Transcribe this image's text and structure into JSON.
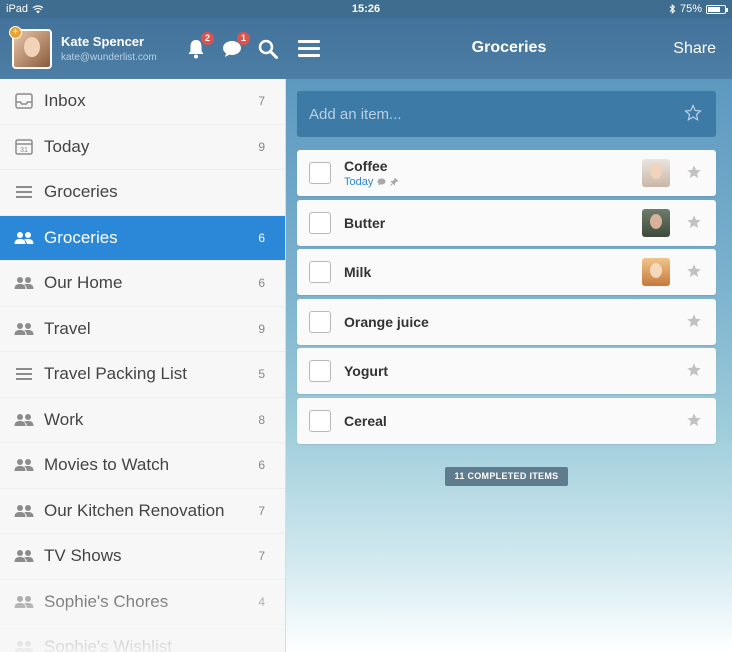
{
  "status_bar": {
    "device": "iPad",
    "time": "15:26",
    "battery": "75%",
    "battery_level": 0.75
  },
  "user": {
    "name": "Kate Spencer",
    "email": "kate@wunderlist.com"
  },
  "header": {
    "notifications_badge": "2",
    "comments_badge": "1",
    "list_title": "Groceries",
    "share_label": "Share"
  },
  "sidebar": {
    "items": [
      {
        "label": "Inbox",
        "count": "7",
        "icon": "inbox-icon"
      },
      {
        "label": "Today",
        "count": "9",
        "icon": "calendar-icon"
      },
      {
        "label": "Groceries",
        "count": "",
        "icon": "list-icon"
      },
      {
        "label": "Groceries",
        "count": "6",
        "icon": "shared-list-icon",
        "active": true
      },
      {
        "label": "Our Home",
        "count": "6",
        "icon": "shared-list-icon"
      },
      {
        "label": "Travel",
        "count": "9",
        "icon": "shared-list-icon"
      },
      {
        "label": "Travel Packing List",
        "count": "5",
        "icon": "list-icon"
      },
      {
        "label": "Work",
        "count": "8",
        "icon": "shared-list-icon"
      },
      {
        "label": "Movies to Watch",
        "count": "6",
        "icon": "shared-list-icon"
      },
      {
        "label": "Our Kitchen Renovation",
        "count": "7",
        "icon": "shared-list-icon"
      },
      {
        "label": "TV Shows",
        "count": "7",
        "icon": "shared-list-icon"
      },
      {
        "label": "Sophie's Chores",
        "count": "4",
        "icon": "shared-list-icon"
      },
      {
        "label": "Sophie's Wishlist",
        "count": "",
        "icon": "shared-list-icon"
      }
    ]
  },
  "main": {
    "add_placeholder": "Add an item...",
    "todos": [
      {
        "title": "Coffee",
        "due": "Today",
        "has_comment": true,
        "has_pin": true,
        "assignee": "woman-avatar"
      },
      {
        "title": "Butter",
        "due": "",
        "assignee": "man-avatar"
      },
      {
        "title": "Milk",
        "due": "",
        "assignee": "redhead-avatar"
      },
      {
        "title": "Orange juice",
        "due": ""
      },
      {
        "title": "Yogurt",
        "due": ""
      },
      {
        "title": "Cereal",
        "due": ""
      }
    ],
    "completed_label": "11 COMPLETED ITEMS"
  },
  "colors": {
    "accent": "#2b88d8",
    "header": "#43729a",
    "badge": "#d9534f"
  }
}
